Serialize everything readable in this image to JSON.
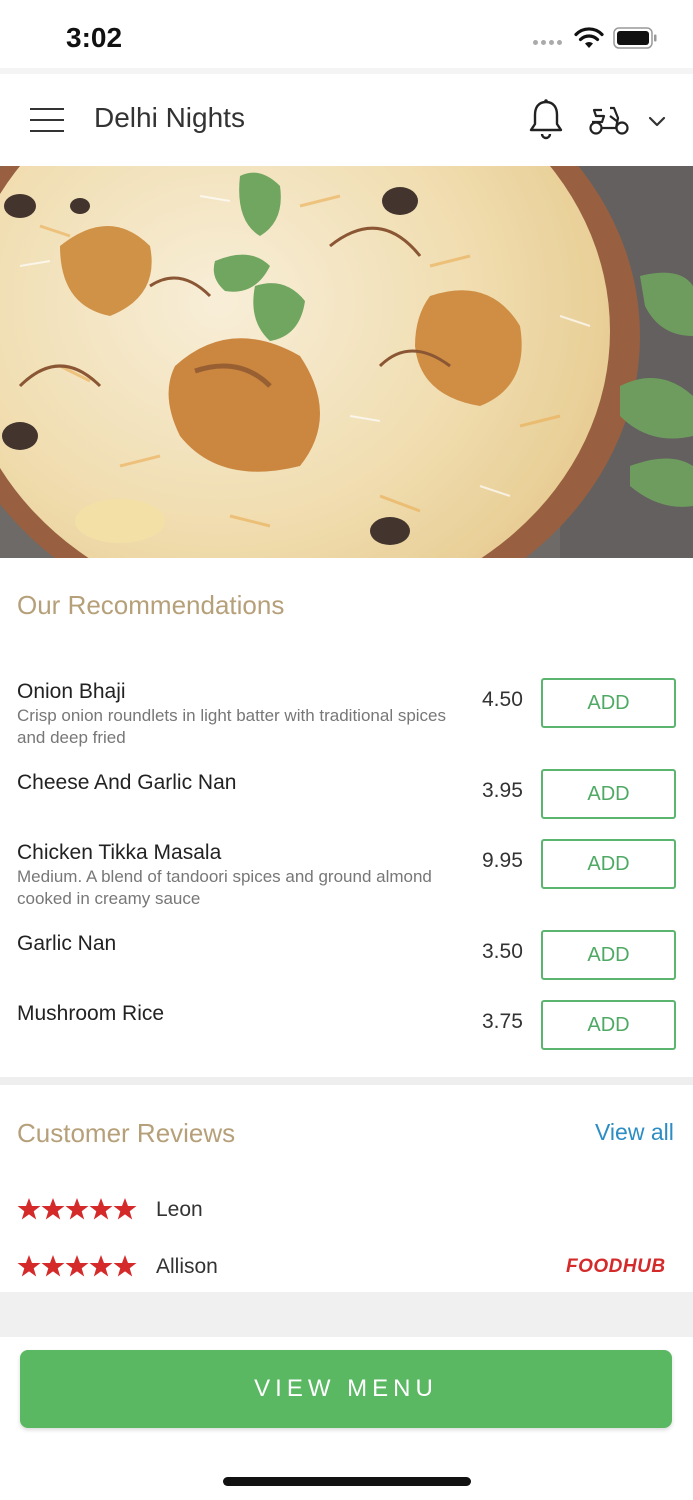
{
  "status_bar": {
    "time": "3:02"
  },
  "header": {
    "title": "Delhi Nights"
  },
  "recommendations": {
    "title": "Our Recommendations",
    "items": [
      {
        "name": "Onion Bhaji",
        "description": "Crisp onion roundlets in light batter with traditional spices and deep fried",
        "price": "4.50",
        "add_label": "ADD"
      },
      {
        "name": "Cheese And Garlic Nan",
        "description": "",
        "price": "3.95",
        "add_label": "ADD"
      },
      {
        "name": "Chicken Tikka Masala",
        "description": "Medium. A blend of tandoori spices and ground almond cooked in creamy sauce",
        "price": "9.95",
        "add_label": "ADD"
      },
      {
        "name": "Garlic Nan",
        "description": "",
        "price": "3.50",
        "add_label": "ADD"
      },
      {
        "name": "Mushroom Rice",
        "description": "",
        "price": "3.75",
        "add_label": "ADD"
      }
    ]
  },
  "reviews": {
    "title": "Customer Reviews",
    "view_all": "View all",
    "items": [
      {
        "name": "Leon",
        "rating": 5
      },
      {
        "name": "Allison",
        "rating": 5,
        "source_logo": "FOODHUB"
      }
    ]
  },
  "footer": {
    "view_menu_label": "VIEW MENU"
  },
  "colors": {
    "accent_green": "#5ab863",
    "section_title": "#b6a07a",
    "link_blue": "#2c8cc4",
    "star_red": "#d42a2a"
  }
}
